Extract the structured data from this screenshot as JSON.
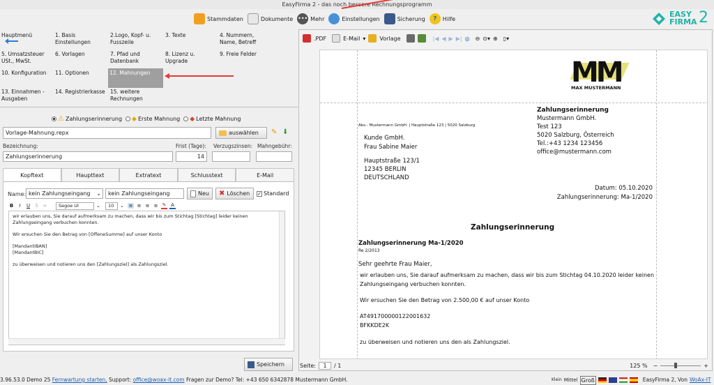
{
  "window": {
    "title": "EasyFirma 2 - das noch bessere Rechnungsprogramm"
  },
  "toolbar": {
    "items": [
      {
        "label": "Stammdaten",
        "icon": "cart-icon"
      },
      {
        "label": "Dokumente",
        "icon": "documents-icon"
      },
      {
        "label": "Mehr",
        "icon": "more-icon"
      },
      {
        "label": "Einstellungen",
        "icon": "settings-gear-icon"
      },
      {
        "label": "Sicherung",
        "icon": "floppy-icon"
      },
      {
        "label": "Hilfe",
        "icon": "help-icon"
      }
    ]
  },
  "logo": {
    "line1": "EASY",
    "line2": "FIRMA",
    "num": "2",
    "color": "#20b3a8"
  },
  "nav": {
    "main": "Hauptmenü",
    "items": [
      "1. Basis Einstellungen",
      "2.Logo, Kopf- u. Fusszeile",
      "3. Texte",
      "4. Nummern, Name, Betreff",
      "5. Umsatzsteuer USt., MwSt.",
      "6. Vorlagen",
      "7. Pfad und Datenbank",
      "8. Lizenz u. Upgrade",
      "9. Freie Felder",
      "10. Konfiguration",
      "11. Optionen",
      "12. Mahnungen",
      "13. Einnahmen - Ausgaben",
      "14. Registrierkasse",
      "15. weitere Rechnungen"
    ],
    "active": "12. Mahnungen"
  },
  "reminder": {
    "levels": [
      "Zahlungserinnerung",
      "Erste Mahnung",
      "Letzte Mahnung"
    ],
    "selected": "Zahlungserinnerung",
    "template_file": "Vorlage-Mahnung.repx",
    "choose_label": "auswählen",
    "labels": {
      "name": "Bezeichnung:",
      "frist": "Frist (Tage):",
      "zinsen": "Verzugszinsen:",
      "gebuehr": "Mahngebühr:"
    },
    "name_value": "Zahlungserinnerung",
    "frist_value": "14",
    "zinsen_value": "",
    "gebuehr_value": ""
  },
  "tabs": [
    "Kopftext",
    "Haupttext",
    "Extratext",
    "Schlusstext",
    "E-Mail"
  ],
  "active_tab": "Kopftext",
  "textblock": {
    "name_label": "Name:",
    "select_value": "kein Zahlungseingang",
    "name_value": "kein Zahlungseingang",
    "new_label": "Neu",
    "delete_label": "Löschen",
    "standard_label": "Standard",
    "standard_checked": true,
    "font": "Segoe UI",
    "size": "10"
  },
  "editor": {
    "paragraphs": [
      "wir erlauben uns, Sie darauf aufmerksam zu machen, dass wir bis zum Stichtag [Stichtag] leider keinen Zahlungseingang verbuchen konnten.",
      "Wir ersuchen Sie den Betrag von [OffeneSumme] auf unser Konto",
      "[MandantIBAN]\n[MandantBIC]",
      "zu überweisen und notieren uns den [Zahlungsziel] als Zahlungsziel."
    ]
  },
  "save_label": "Speichern",
  "preview": {
    "toolbar": {
      "pdf": ".PDF",
      "email": "E-Mail",
      "vorlage": "Vorlage"
    },
    "sender_line": "Abs.: Mustermann GmbH. | Hauptstraße 123 | 5020 Salzburg",
    "logo_text": "MM",
    "logo_sub": "MAX MUSTERMANN",
    "company_heading": "Zahlungserinnerung",
    "company": [
      "Mustermann GmbH.",
      "Test 123",
      "5020 Salzburg, Österreich",
      "Tel.:+43 1234 123456",
      "office@mustermann.com"
    ],
    "recipient": [
      "Kunde GmbH.",
      "Frau Sabine Maier",
      "",
      "Hauptstraße 123/1",
      "12345 BERLIN",
      "DEUTSCHLAND"
    ],
    "date": "Datum: 05.10.2020",
    "ref": "Zahlungserinnerung: Ma-1/2020",
    "heading": "Zahlungserinnerung",
    "subheading": "Zahlungserinnerung Ma-1/2020",
    "invoice_ref": "Re 2/2013",
    "salutation": "Sehr geehrte Frau Maier,",
    "body1": "wir erlauben uns, Sie darauf aufmerksam zu machen, dass wir bis zum Stichtag 04.10.2020 leider keinen",
    "body2": "Zahlungseingang verbuchen konnten.",
    "body3": "Wir ersuchen Sie den Betrag von 2.500,00 € auf unser Konto",
    "iban": "AT491700000122001632",
    "bic": "BFKKDE2K",
    "body4": "zu überweisen und notieren uns den  als Zahlungsziel.",
    "page_label": "Seite:",
    "page_current": "1",
    "page_total": "/ 1",
    "zoom": "125 %"
  },
  "status": {
    "version": "3.96.53.0 Demo 25",
    "remote": "Fernwartung starten,",
    "support_label": "Support:",
    "support_email": "office@woax-it.com",
    "demo_text": "Fragen zur Demo? Tel: +43 650 6342878 Mustermann GmbH.",
    "sizes": [
      "Klein",
      "Mittel",
      "Groß"
    ],
    "active_size": "Groß",
    "product": "EasyFirma 2, Von",
    "vendor": "WoAx-IT"
  }
}
